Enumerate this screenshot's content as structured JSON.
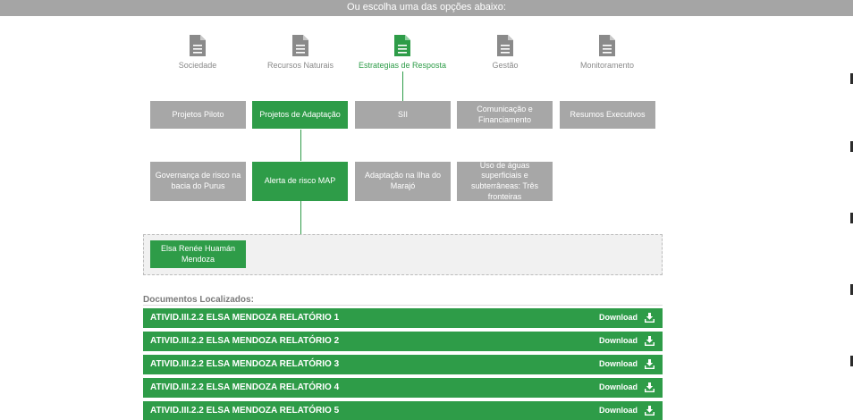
{
  "header": {
    "prompt": "Ou escolha uma das opções abaixo:"
  },
  "categories": [
    {
      "label": "Sociedade",
      "active": false,
      "icon": "document-icon"
    },
    {
      "label": "Recursos Naturais",
      "active": false,
      "icon": "document-icon"
    },
    {
      "label": "Estrategias de Resposta",
      "active": true,
      "icon": "document-icon"
    },
    {
      "label": "Gestão",
      "active": false,
      "icon": "document-icon"
    },
    {
      "label": "Monitoramento",
      "active": false,
      "icon": "document-icon"
    }
  ],
  "subcategories": [
    {
      "label": "Projetos Piloto",
      "active": false
    },
    {
      "label": "Projetos de Adaptação",
      "active": true
    },
    {
      "label": "SII",
      "active": false
    },
    {
      "label": "Comunicação e Financiamento",
      "active": false
    },
    {
      "label": "Resumos Executivos",
      "active": false
    }
  ],
  "projects": [
    {
      "label": "Governança de risco na bacia do Purus",
      "active": false
    },
    {
      "label": "Alerta de risco MAP",
      "active": true
    },
    {
      "label": "Adaptação na Ilha do Marajó",
      "active": false
    },
    {
      "label": "Uso de águas superficiais e subterrâneas: Três fronteiras",
      "active": false
    }
  ],
  "person": {
    "label": "Elsa Renée Huamán Mendoza"
  },
  "documents": {
    "heading": "Documentos Localizados:",
    "download_label": "Download",
    "items": [
      {
        "title": "ATIVID.III.2.2 ELSA MENDOZA RELATÓRIO 1"
      },
      {
        "title": "ATIVID.III.2.2 ELSA MENDOZA RELATÓRIO 2"
      },
      {
        "title": "ATIVID.III.2.2 ELSA MENDOZA RELATÓRIO 3"
      },
      {
        "title": "ATIVID.III.2.2 ELSA MENDOZA RELATÓRIO 4"
      },
      {
        "title": "ATIVID.III.2.2 ELSA MENDOZA RELATÓRIO 5"
      }
    ]
  },
  "colors": {
    "accent": "#2e9c48",
    "inactive": "#a7a7a7",
    "topbar": "#a5a5a5"
  }
}
